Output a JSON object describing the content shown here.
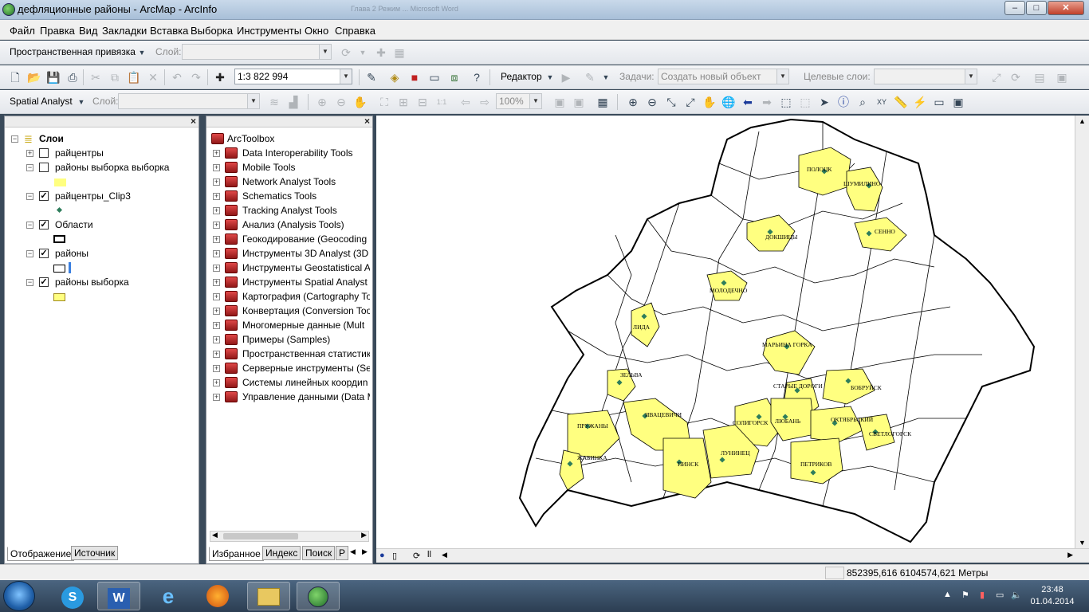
{
  "window": {
    "title": "дефляционные районы - ArcMap - ArcInfo",
    "background_title": "Глава 2 Режим ... Microsoft Word",
    "controls": {
      "minimize": "–",
      "maximize": "□",
      "close": "✕"
    }
  },
  "menubar": {
    "items": [
      "Файл",
      "Правка",
      "Вид",
      "Закладки",
      "Вставка",
      "Выборка",
      "Инструменты",
      "Окно",
      "Справка"
    ]
  },
  "toolbar_georef": {
    "label": "Пространственная привязка",
    "layer_label": "Слой:",
    "layer_value": ""
  },
  "toolbar_standard": {
    "scale": "1:3 822 994",
    "editor_label": "Редактор",
    "tasks_label": "Задачи:",
    "task_value": "Создать новый объект",
    "target_label": "Целевые слои:",
    "target_value": ""
  },
  "toolbar_spatial": {
    "label": "Spatial Analyst",
    "layer_label": "Слой:",
    "layer_value": "",
    "zoom": "100%"
  },
  "toc": {
    "root": "Слои",
    "layers": [
      {
        "name": "райцентры",
        "checked": false,
        "swatch": "none"
      },
      {
        "name": "районы выборка выборка",
        "checked": false,
        "swatch": "yellow-fill"
      },
      {
        "name": "райцентры_Clip3",
        "checked": true,
        "swatch": "green-dot"
      },
      {
        "name": "Области",
        "checked": true,
        "swatch": "black-outline"
      },
      {
        "name": "районы",
        "checked": true,
        "swatch": "outline"
      },
      {
        "name": "районы выборка",
        "checked": true,
        "swatch": "yellow-outline"
      }
    ],
    "tabs": [
      "Отображение",
      "Источник"
    ]
  },
  "toolbox": {
    "root": "ArcToolbox",
    "items": [
      "Data Interoperability Tools",
      "Mobile Tools",
      "Network Analyst Tools",
      "Schematics Tools",
      "Tracking Analyst Tools",
      "Анализ (Analysis Tools)",
      "Геокодирование (Geocoding",
      "Инструменты 3D Analyst (3D",
      "Инструменты Geostatistical A",
      "Инструменты Spatial Analyst",
      "Картография (Cartography To",
      "Конвертация (Conversion Too",
      "Многомерные данные (Mult",
      "Примеры (Samples)",
      "Пространственная статистик",
      "Серверные инструменты (Se",
      "Системы линейных коордиn",
      "Управление данными (Data M"
    ],
    "tabs": [
      "Избранное",
      "Индекс",
      "Поиск",
      "Р"
    ]
  },
  "map": {
    "fill_color": "#ffff80",
    "outline_color": "#000000",
    "point_color": "#2e7d5b",
    "labels": [
      "ПОЛОЦК",
      "ШУМИЛИНО",
      "ДОКШИЦЫ",
      "СЕННО",
      "МОЛОДЕЧНО",
      "ЛИДА",
      "МАРЬИНА ГОРКА",
      "ЗЕЛЬВА",
      "СТАРЫЕ ДОРОГИ",
      "БОБРУЙСК",
      "ИВАЦЕВИЧИ",
      "ПРУЖАНЫ",
      "СОЛИГОРСК",
      "ЛЮБАНЬ",
      "ОКТЯБРЬСКИЙ",
      "СВЕТЛОГОРСК",
      "ЖАБИНКА",
      "ПИНСК",
      "ЛУНИНЕЦ",
      "ПЕТРИКОВ"
    ]
  },
  "statusbar": {
    "coords": "852395,616  6104574,621 Метры"
  },
  "taskbar": {
    "clock_time": "23:48",
    "clock_date": "01.04.2014",
    "apps": [
      "Skype",
      "Word",
      "Internet Explorer",
      "Firefox",
      "Explorer",
      "ArcMap"
    ]
  }
}
